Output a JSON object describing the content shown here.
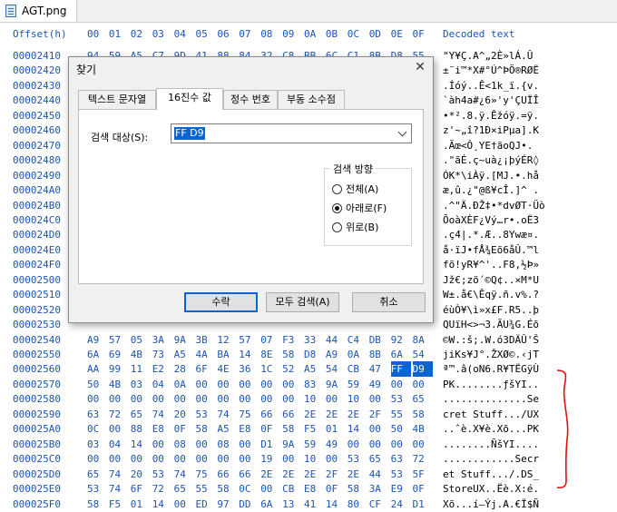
{
  "file_tab": {
    "title": "AGT.png"
  },
  "header": {
    "offset_label": "Offset(h)",
    "columns": [
      "00",
      "01",
      "02",
      "03",
      "04",
      "05",
      "06",
      "07",
      "08",
      "09",
      "0A",
      "0B",
      "0C",
      "0D",
      "0E",
      "0F"
    ],
    "decoded_label": "Decoded text"
  },
  "rows": [
    {
      "offset": "00002410",
      "hex": [
        "94",
        "59",
        "A5",
        "C7",
        "9D",
        "41",
        "88",
        "84",
        "32",
        "C8",
        "BB",
        "6C",
        "C1",
        "8B",
        "D8",
        "55"
      ],
      "text": "\"Y¥Ç.A^„2È»lÁ.Û"
    },
    {
      "offset": "00002420",
      "hex": [
        "",
        "",
        "",
        "",
        "",
        "",
        "",
        "",
        "",
        "",
        "",
        "",
        "",
        "",
        "",
        ""
      ],
      "text": "±¨i™*X#°Ú^ÞÖ®RØË"
    },
    {
      "offset": "00002430",
      "hex": [
        "",
        "",
        "",
        "",
        "",
        "",
        "",
        "",
        "",
        "",
        "",
        "",
        "",
        "",
        "",
        ""
      ],
      "text": ".Íóý..Ê<1k_ï.{v."
    },
    {
      "offset": "00002440",
      "hex": [
        "",
        "",
        "",
        "",
        "",
        "",
        "",
        "",
        "",
        "",
        "",
        "",
        "",
        "",
        "",
        ""
      ],
      "text": "`àh4a#¿6»'y'ÇUÏÎ"
    },
    {
      "offset": "00002450",
      "hex": [
        "",
        "",
        "",
        "",
        "",
        "",
        "",
        "",
        "",
        "",
        "",
        "",
        "",
        "",
        "",
        ""
      ],
      "text": "•*².8.ÿ.Êžóÿ.=ÿ."
    },
    {
      "offset": "00002460",
      "hex": [
        "",
        "",
        "",
        "",
        "",
        "",
        "",
        "",
        "",
        "",
        "",
        "",
        "",
        "",
        "",
        ""
      ],
      "text": "z'~„î?1Ð×iPµa].K"
    },
    {
      "offset": "00002470",
      "hex": [
        "",
        "",
        "",
        "",
        "",
        "",
        "",
        "",
        "",
        "",
        "",
        "",
        "",
        "",
        "",
        ""
      ],
      "text": ".Ãœ<Ô¸YE†ãoQJ•."
    },
    {
      "offset": "00002480",
      "hex": [
        "",
        "",
        "",
        "",
        "",
        "",
        "",
        "",
        "",
        "",
        "",
        "",
        "",
        "",
        "",
        ""
      ],
      "text": ".\"ãÉ.ç~uà¿¡þýÉR◊"
    },
    {
      "offset": "00002490",
      "hex": [
        "",
        "",
        "",
        "",
        "",
        "",
        "",
        "",
        "",
        "",
        "",
        "",
        "",
        "",
        "",
        ""
      ],
      "text": "ÓK*\\iÀÿ.[MJ.•.hå"
    },
    {
      "offset": "000024A0",
      "hex": [
        "",
        "",
        "",
        "",
        "",
        "",
        "",
        "",
        "",
        "",
        "",
        "",
        "",
        "",
        "",
        ""
      ],
      "text": "æ,û.¿\"@ß¥cÎ.]^ ."
    },
    {
      "offset": "000024B0",
      "hex": [
        "",
        "",
        "",
        "",
        "",
        "",
        "",
        "",
        "",
        "",
        "",
        "",
        "",
        "",
        "",
        ""
      ],
      "text": ".^\"Ä.ÐŽ‡•*dvØT·Üò"
    },
    {
      "offset": "000024C0",
      "hex": [
        "",
        "",
        "",
        "",
        "",
        "",
        "",
        "",
        "",
        "",
        "",
        "",
        "",
        "",
        "",
        ""
      ],
      "text": "ÕoàXÈF¿Vý…r•.oË3"
    },
    {
      "offset": "000024D0",
      "hex": [
        "",
        "",
        "",
        "",
        "",
        "",
        "",
        "",
        "",
        "",
        "",
        "",
        "",
        "",
        "",
        ""
      ],
      "text": ".ç4|.*.Æ..8Ywæ¤."
    },
    {
      "offset": "000024E0",
      "hex": [
        "",
        "",
        "",
        "",
        "",
        "",
        "",
        "",
        "",
        "",
        "",
        "",
        "",
        "",
        "",
        ""
      ],
      "text": "å·ïJ•fÅ¾Eõ6åÛ.™l"
    },
    {
      "offset": "000024F0",
      "hex": [
        "",
        "",
        "",
        "",
        "",
        "",
        "",
        "",
        "",
        "",
        "",
        "",
        "",
        "",
        "",
        ""
      ],
      "text": "fõ!yR¥^'..F8,½Þ»"
    },
    {
      "offset": "00002500",
      "hex": [
        "",
        "",
        "",
        "",
        "",
        "",
        "",
        "",
        "",
        "",
        "",
        "",
        "",
        "",
        "",
        ""
      ],
      "text": "Jž€;zö´©Q¢..×M*U"
    },
    {
      "offset": "00002510",
      "hex": [
        "",
        "",
        "",
        "",
        "",
        "",
        "",
        "",
        "",
        "",
        "",
        "",
        "",
        "",
        "",
        ""
      ],
      "text": "W±.å€\\Êqÿ.ñ.v%.?"
    },
    {
      "offset": "00002520",
      "hex": [
        "",
        "",
        "",
        "",
        "",
        "",
        "",
        "",
        "",
        "",
        "",
        "",
        "",
        "",
        "",
        ""
      ],
      "text": "éùÒ¥\\ì»x£F.R5..þ"
    },
    {
      "offset": "00002530",
      "hex": [
        "",
        "",
        "",
        "",
        "",
        "",
        "",
        "",
        "",
        "",
        "",
        "",
        "",
        "",
        "",
        ""
      ],
      "text": "QUïH<>¬3.ÃU¾G.Éõ"
    },
    {
      "offset": "00002540",
      "hex": [
        "A9",
        "57",
        "05",
        "3A",
        "9A",
        "3B",
        "12",
        "57",
        "07",
        "F3",
        "33",
        "44",
        "C4",
        "DB",
        "92",
        "8A"
      ],
      "text": "©W.:š;.W.ó3DÄÛ'Š"
    },
    {
      "offset": "00002550",
      "hex": [
        "6A",
        "69",
        "4B",
        "73",
        "A5",
        "4A",
        "BA",
        "14",
        "8E",
        "58",
        "D8",
        "A9",
        "0A",
        "8B",
        "6A",
        "54"
      ],
      "text": "jiKs¥J°.ŽXØ©.‹jT"
    },
    {
      "offset": "00002560",
      "hex": [
        "AA",
        "99",
        "11",
        "E2",
        "28",
        "6F",
        "4E",
        "36",
        "1C",
        "52",
        "A5",
        "54",
        "CB",
        "47",
        "FF",
        "D9"
      ],
      "text": "ª™.â(oN6.R¥TËGÿÙ"
    },
    {
      "offset": "00002570",
      "hex": [
        "50",
        "4B",
        "03",
        "04",
        "0A",
        "00",
        "00",
        "00",
        "00",
        "00",
        "83",
        "9A",
        "59",
        "49",
        "00",
        "00"
      ],
      "text": "PK........ƒšYI.."
    },
    {
      "offset": "00002580",
      "hex": [
        "00",
        "00",
        "00",
        "00",
        "00",
        "00",
        "00",
        "00",
        "00",
        "00",
        "10",
        "00",
        "10",
        "00",
        "53",
        "65"
      ],
      "text": "..............Se"
    },
    {
      "offset": "00002590",
      "hex": [
        "63",
        "72",
        "65",
        "74",
        "20",
        "53",
        "74",
        "75",
        "66",
        "66",
        "2E",
        "2E",
        "2E",
        "2F",
        "55",
        "58"
      ],
      "text": "cret Stuff.../UX"
    },
    {
      "offset": "000025A0",
      "hex": [
        "0C",
        "00",
        "88",
        "E8",
        "0F",
        "58",
        "A5",
        "E8",
        "0F",
        "58",
        "F5",
        "01",
        "14",
        "00",
        "50",
        "4B"
      ],
      "text": "..ˆè.X¥è.Xõ...PK"
    },
    {
      "offset": "000025B0",
      "hex": [
        "03",
        "04",
        "14",
        "00",
        "08",
        "00",
        "08",
        "00",
        "D1",
        "9A",
        "59",
        "49",
        "00",
        "00",
        "00",
        "00"
      ],
      "text": "........ÑšYI...."
    },
    {
      "offset": "000025C0",
      "hex": [
        "00",
        "00",
        "00",
        "00",
        "00",
        "00",
        "00",
        "00",
        "19",
        "00",
        "10",
        "00",
        "53",
        "65",
        "63",
        "72"
      ],
      "text": "............Secr"
    },
    {
      "offset": "000025D0",
      "hex": [
        "65",
        "74",
        "20",
        "53",
        "74",
        "75",
        "66",
        "66",
        "2E",
        "2E",
        "2E",
        "2F",
        "2E",
        "44",
        "53",
        "5F"
      ],
      "text": "et Stuff.../.DS_"
    },
    {
      "offset": "000025E0",
      "hex": [
        "53",
        "74",
        "6F",
        "72",
        "65",
        "55",
        "58",
        "0C",
        "00",
        "CB",
        "E8",
        "0F",
        "58",
        "3A",
        "E9",
        "0F"
      ],
      "text": "StoreUX..Ëè.X:é."
    },
    {
      "offset": "000025F0",
      "hex": [
        "58",
        "F5",
        "01",
        "14",
        "00",
        "ED",
        "97",
        "DD",
        "6A",
        "13",
        "41",
        "14",
        "80",
        "CF",
        "24",
        "D1"
      ],
      "text": "Xõ...í—Ýj.A.€Ï$Ñ"
    }
  ],
  "dialog": {
    "title": "찾기",
    "close": "✕",
    "tabs": [
      "텍스트 문자열",
      "16진수 값",
      "정수 번호",
      "부동 소수점"
    ],
    "active_tab": 1,
    "target_label": "검색 대상(S):",
    "target_value": "FF D9",
    "direction_label": "검색 방향",
    "directions": [
      "전체(A)",
      "아래로(F)",
      "위로(B)"
    ],
    "selected_direction": 1,
    "buttons": {
      "find": "수락",
      "find_all": "모두 검색(A)",
      "cancel": "취소"
    }
  },
  "colors": {
    "accent": "#0a64d2",
    "hex_text": "#1b55b5",
    "annotation": "#e01010"
  }
}
